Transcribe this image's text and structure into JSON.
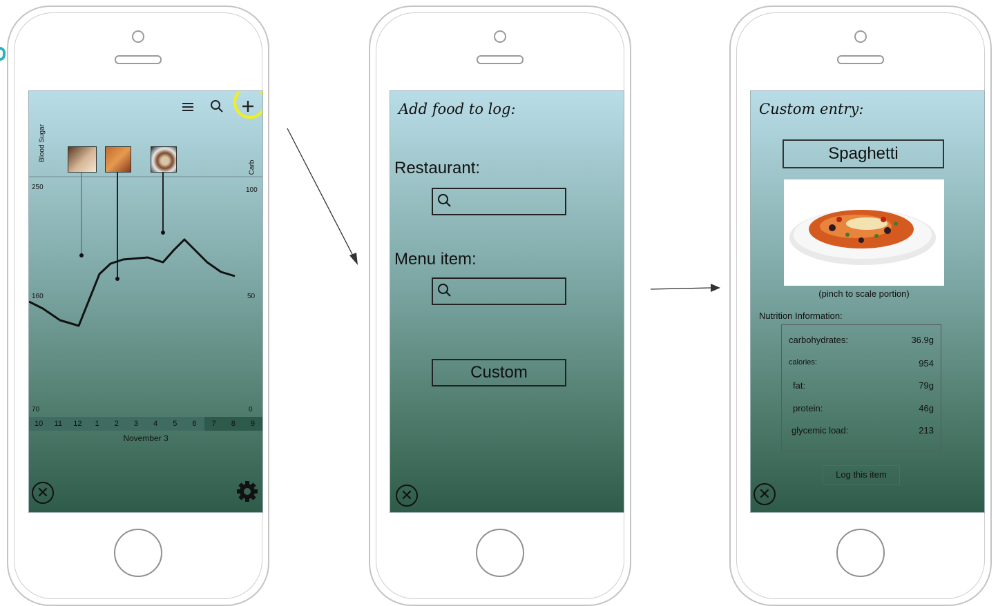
{
  "screen1": {
    "y_axis_label": "Blood Sugar",
    "right_axis_label": "Carb",
    "left_ticks": [
      "250",
      "160",
      "70"
    ],
    "right_ticks": [
      "100",
      "50",
      "0"
    ],
    "hours": [
      "10",
      "11",
      "12",
      "1",
      "2",
      "3",
      "4",
      "5",
      "6",
      "7",
      "8",
      "9"
    ],
    "date_label": "November 3",
    "icons": [
      "menu-icon",
      "search-icon",
      "plus-icon",
      "close-icon",
      "gear-icon"
    ],
    "highlight_color": "#f2ee1f"
  },
  "screen2": {
    "title": "Add food to log:",
    "restaurant_label": "Restaurant:",
    "menu_item_label": "Menu item:",
    "custom_button": "Custom"
  },
  "screen3": {
    "title": "Custom entry:",
    "food_name": "Spaghetti",
    "portion_hint": "(pinch to scale portion)",
    "nutrition_header": "Nutrition Information:",
    "nutrition": [
      {
        "label": "carbohydrates:",
        "value": "36.9g"
      },
      {
        "label": "calories:",
        "value": "954"
      },
      {
        "label": "fat:",
        "value": "79g"
      },
      {
        "label": "protein:",
        "value": "46g"
      },
      {
        "label": "glycemic load:",
        "value": "213"
      }
    ],
    "log_button": "Log this item"
  }
}
